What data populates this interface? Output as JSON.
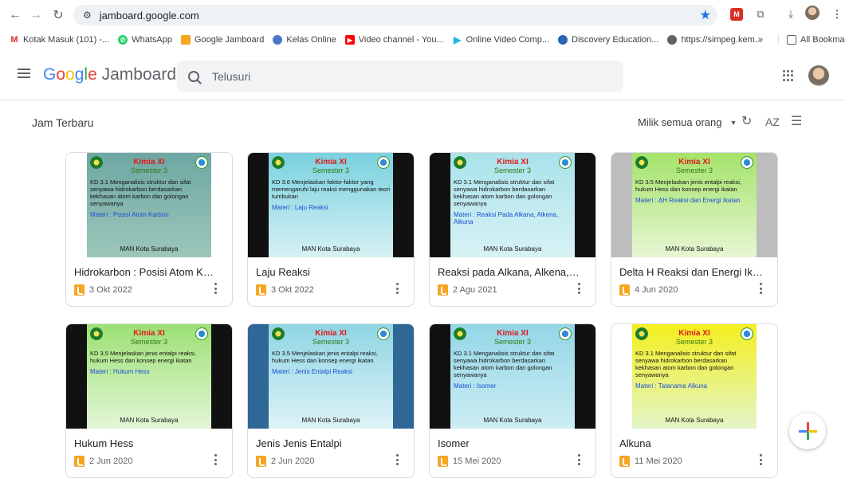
{
  "browser": {
    "url": "jamboard.google.com",
    "bookmarks": [
      {
        "label": "Kotak Masuk (101) -...",
        "icon": "gmail-icon",
        "color": "#d93025"
      },
      {
        "label": "WhatsApp",
        "icon": "whatsapp-icon",
        "color": "#25d366"
      },
      {
        "label": "Google Jamboard",
        "icon": "jamboard-icon",
        "color": "#f6a623"
      },
      {
        "label": "Kelas Online",
        "icon": "kelas-icon",
        "color": "#4a76c8"
      },
      {
        "label": "Video channel - You...",
        "icon": "youtube-icon",
        "color": "#ff0000"
      },
      {
        "label": "Online Video Comp...",
        "icon": "play-icon",
        "color": "#1fb7e8"
      },
      {
        "label": "Discovery Education...",
        "icon": "discovery-icon",
        "color": "#2a64b4"
      },
      {
        "label": "https://simpeg.kem...",
        "icon": "globe-icon",
        "color": "#5f6368"
      }
    ],
    "more": "»",
    "all_bookmarks": "All Bookmarks"
  },
  "app": {
    "brand_google": "Google",
    "brand_product": "Jamboard",
    "search_placeholder": "Telusuri",
    "section_title": "Jam Terbaru",
    "owner_filter": "Milik semua orang",
    "sort_label": "AZ"
  },
  "boards": [
    {
      "title": "Hidrokarbon : Posisi Atom Karbon",
      "date": "3 Okt 2022",
      "thumb": {
        "bg": "linear-gradient(180deg,#6da7a3,#9cc6b9)",
        "frame": "#ffffff",
        "heading": "Kimia XI",
        "semester": "Semester 3",
        "kd": "KD 3.1 Menganalisis struktur dan sifat senyawa hidrokarbon berdasarkan kekhasan atom karbon dan golongan senyawanya",
        "materi": "Materi : Posisi Atom Karbon",
        "school": "MAN Kota Surabaya"
      }
    },
    {
      "title": "Laju Reaksi",
      "date": "3 Okt 2022",
      "thumb": {
        "bg": "linear-gradient(180deg,#7ad1e0,#d6f1f3)",
        "frame": "#111111",
        "heading": "Kimia XI",
        "semester": "Semester 3",
        "kd": "KD 3.6 Menjelaskan faktor-faktor yang memengaruhi laju reaksi menggunakan teori tumbukan",
        "materi": "Materi : Laju Reaksi",
        "school": "MAN Kota Surabaya"
      }
    },
    {
      "title": "Reaksi pada Alkana, Alkena, Alku...",
      "date": "2 Agu 2021",
      "thumb": {
        "bg": "linear-gradient(180deg,#a9e2ea,#d8f2f5)",
        "frame": "#111111",
        "heading": "Kimia XI",
        "semester": "Semester 3",
        "kd": "KD 3.1 Menganalisis struktur dan sifat senyawa hidrokarbon berdasarkan kekhasan atom karbon dan golongan senyawanya",
        "materi": "Materi : Reaksi Pada Alkana, Alkena, Alkuna",
        "school": "MAN Kota Surabaya"
      }
    },
    {
      "title": "Delta H Reaksi dan Energi Ikatan",
      "date": "4 Jun 2020",
      "thumb": {
        "bg": "linear-gradient(180deg,#a4e36a,#e8f6d4)",
        "frame": "#bdbdbd",
        "heading": "Kimia XI",
        "semester": "Semester 3",
        "kd": "KD 3.5 Menjelaskan jenis entalpi reaksi, hukum Hess dan konsep energi ikatan",
        "materi": "Materi : ΔH Reaksi dan Energi Ikatan",
        "school": "MAN Kota Surabaya"
      }
    },
    {
      "title": "Hukum Hess",
      "date": "2 Jun 2020",
      "thumb": {
        "bg": "linear-gradient(180deg,#9ce074,#e3f6d6)",
        "frame": "#111111",
        "heading": "Kimia XI",
        "semester": "Semester 3",
        "kd": "KD 3.5 Menjelaskan jenis entalpi reaksi, hukum Hess dan konsep energi ikatan",
        "materi": "Materi : Hukum Hess",
        "school": "MAN Kota Surabaya"
      }
    },
    {
      "title": "Jenis Jenis Entalpi",
      "date": "2 Jun 2020",
      "thumb": {
        "bg": "linear-gradient(180deg,#8fd5e4,#def3f7)",
        "frame": "#2f6797",
        "heading": "Kimia XI",
        "semester": "Semester 3",
        "kd": "KD 3.5 Menjelaskan jenis entalpi reaksi, hukum Hess dan konsep energi ikatan",
        "materi": "Materi : Jenis Entalpi Reaksi",
        "school": "MAN Kota Surabaya"
      }
    },
    {
      "title": "Isomer",
      "date": "15 Mei 2020",
      "thumb": {
        "bg": "linear-gradient(180deg,#93d6e6,#cdeef4)",
        "frame": "#111111",
        "heading": "Kimia XI",
        "semester": "Semester 3",
        "kd": "KD 3.1 Menganalisis struktur dan sifat senyawa hidrokarbon berdasarkan kekhasan atom karbon dan golongan senyawanya",
        "materi": "Materi : Isomer",
        "school": "MAN Kota Surabaya"
      }
    },
    {
      "title": "Alkuna",
      "date": "11 Mei 2020",
      "thumb": {
        "bg": "linear-gradient(180deg,#f4ef1e,#e2f5c8)",
        "frame": "#ffffff",
        "heading": "Kimia XI",
        "semester": "Semester 3",
        "kd": "KD 3.1 Menganalisis struktur dan sifat senyawa hidrokarbon berdasarkan kekhasan atom karbon dan golongan senyawanya",
        "materi": "Materi : Tatanama Alkuna",
        "school": "MAN Kota Surabaya"
      }
    }
  ],
  "colors": {
    "accent": "#1a73e8",
    "google_blue": "#4285f4",
    "google_red": "#ea4335",
    "google_yellow": "#fbbc05",
    "google_green": "#34a853"
  }
}
